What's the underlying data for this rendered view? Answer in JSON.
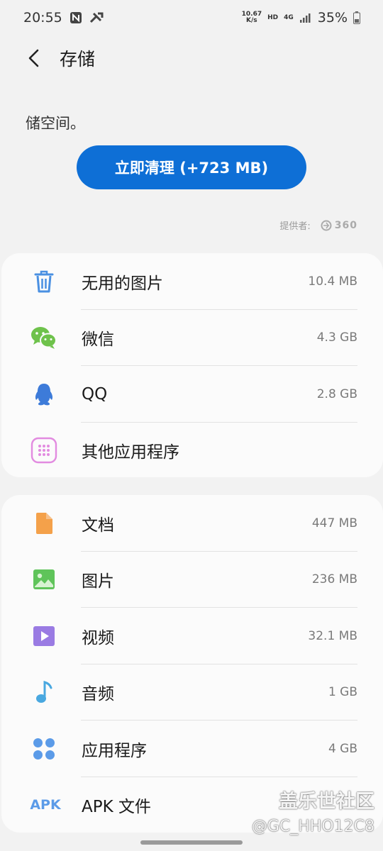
{
  "status_bar": {
    "time": "20:55",
    "net_speed_value": "10.67",
    "net_speed_unit": "K/s",
    "hd": "HD",
    "network_type": "4G",
    "battery": "35%"
  },
  "header": {
    "title": "存储"
  },
  "description": "储空间。",
  "clean_button": {
    "label": "立即清理 (+723 MB)"
  },
  "provider": {
    "label": "提供者:",
    "brand": "360"
  },
  "card1": {
    "items": [
      {
        "label": "无用的图片",
        "value": "10.4 MB",
        "icon": "trash-icon"
      },
      {
        "label": "微信",
        "value": "4.3 GB",
        "icon": "wechat-icon"
      },
      {
        "label": "QQ",
        "value": "2.8 GB",
        "icon": "qq-icon"
      },
      {
        "label": "其他应用程序",
        "value": "",
        "icon": "apps-grid-icon"
      }
    ]
  },
  "card2": {
    "items": [
      {
        "label": "文档",
        "value": "447 MB",
        "icon": "document-icon"
      },
      {
        "label": "图片",
        "value": "236 MB",
        "icon": "image-icon"
      },
      {
        "label": "视频",
        "value": "32.1 MB",
        "icon": "video-icon"
      },
      {
        "label": "音频",
        "value": "1 GB",
        "icon": "music-note-icon"
      },
      {
        "label": "应用程序",
        "value": "4 GB",
        "icon": "apps-dots-icon"
      },
      {
        "label": "APK 文件",
        "value": "",
        "icon": "apk-icon",
        "icon_text": "APK"
      }
    ]
  },
  "watermark": {
    "line1": "盖乐世社区",
    "line2": "@GC_HHO12C8"
  },
  "colors": {
    "accent": "#0e6fd6",
    "background": "#f2f2f2",
    "card": "#fbfbfb"
  }
}
